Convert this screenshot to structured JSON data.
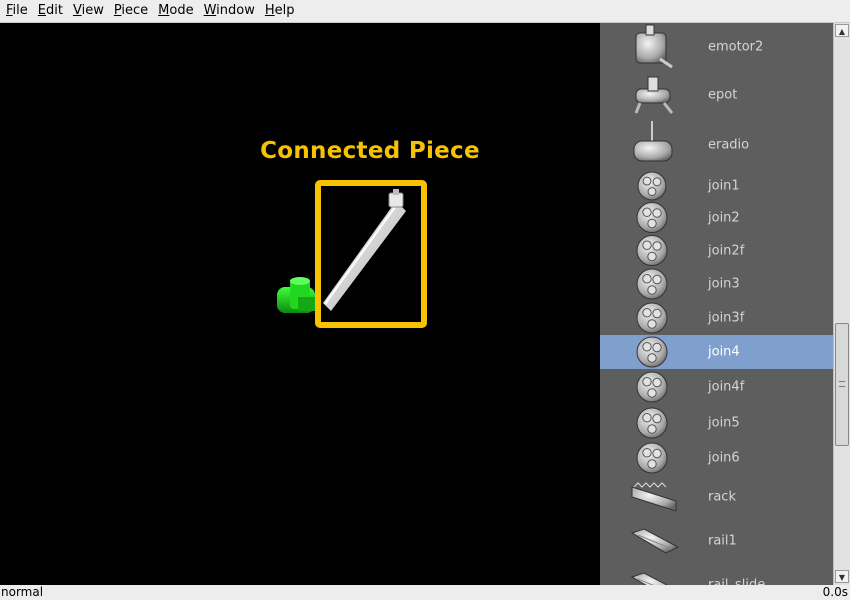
{
  "menu": {
    "items": [
      {
        "first": "F",
        "rest": "ile"
      },
      {
        "first": "E",
        "rest": "dit"
      },
      {
        "first": "V",
        "rest": "iew"
      },
      {
        "first": "P",
        "rest": "iece"
      },
      {
        "first": "M",
        "rest": "ode"
      },
      {
        "first": "W",
        "rest": "indow"
      },
      {
        "first": "H",
        "rest": "elp"
      }
    ]
  },
  "viewport": {
    "annotation_label": "Connected Piece",
    "annotation_color": "#f7c300",
    "connected_piece_color": "#e6e6e6",
    "base_piece_color": "#1fcf1f"
  },
  "palette": {
    "selected": "join4",
    "selection_color": "#7f9fcd",
    "pieces": [
      {
        "label": "emotor2",
        "icon": "motor-icon"
      },
      {
        "label": "epot",
        "icon": "potentiometer-icon"
      },
      {
        "label": "eradio",
        "icon": "radio-icon"
      },
      {
        "label": "join1",
        "icon": "join-icon"
      },
      {
        "label": "join2",
        "icon": "join-icon"
      },
      {
        "label": "join2f",
        "icon": "join-icon"
      },
      {
        "label": "join3",
        "icon": "join-icon"
      },
      {
        "label": "join3f",
        "icon": "join-icon"
      },
      {
        "label": "join4",
        "icon": "join-icon"
      },
      {
        "label": "join4f",
        "icon": "join-icon"
      },
      {
        "label": "join5",
        "icon": "join-icon"
      },
      {
        "label": "join6",
        "icon": "join-icon"
      },
      {
        "label": "rack",
        "icon": "rack-icon"
      },
      {
        "label": "rail1",
        "icon": "rail-icon"
      },
      {
        "label": "rail_slide",
        "icon": "rail-icon"
      }
    ]
  },
  "status": {
    "mode": "normal",
    "time": "0.0s"
  }
}
